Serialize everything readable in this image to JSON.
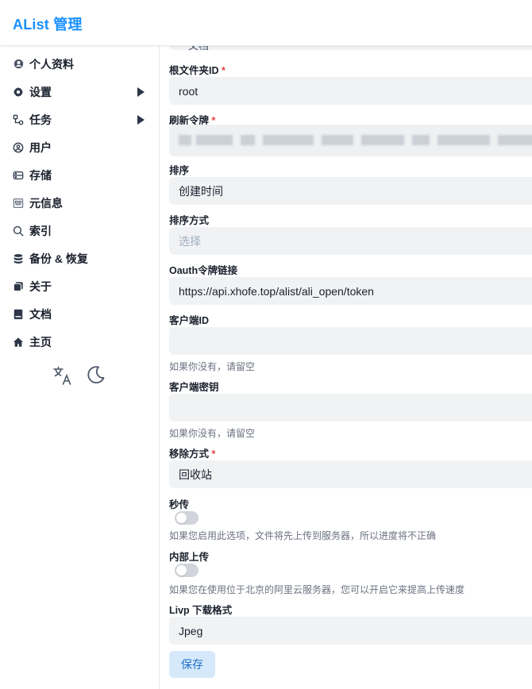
{
  "app": {
    "logo": "AList 管理"
  },
  "sidebar": {
    "items": [
      {
        "label": "个人资料",
        "icon": "user-circle-icon",
        "has_submenu": false
      },
      {
        "label": "设置",
        "icon": "gear-icon",
        "has_submenu": true
      },
      {
        "label": "任务",
        "icon": "tasks-icon",
        "has_submenu": true
      },
      {
        "label": "用户",
        "icon": "user-icon",
        "has_submenu": false
      },
      {
        "label": "存储",
        "icon": "database-icon",
        "has_submenu": false
      },
      {
        "label": "元信息",
        "icon": "meta-icon",
        "has_submenu": false
      },
      {
        "label": "索引",
        "icon": "search-icon",
        "has_submenu": false
      },
      {
        "label": "备份 & 恢复",
        "icon": "backup-icon",
        "has_submenu": false
      },
      {
        "label": "关于",
        "icon": "info-icon",
        "has_submenu": false
      },
      {
        "label": "文档",
        "icon": "book-icon",
        "has_submenu": false
      },
      {
        "label": "主页",
        "icon": "home-icon",
        "has_submenu": false
      }
    ],
    "tools": {
      "language_icon": "translate-icon",
      "theme_icon": "moon-icon"
    }
  },
  "form": {
    "cut_field_value": "文档",
    "root_folder_id": {
      "label": "根文件夹ID",
      "required": true,
      "value": "root"
    },
    "refresh_token": {
      "label": "刷新令牌",
      "required": true,
      "value_note": "blurred"
    },
    "order_by": {
      "label": "排序",
      "value": "创建时间"
    },
    "order_direction": {
      "label": "排序方式",
      "placeholder": "选择"
    },
    "oauth_token_url": {
      "label": "Oauth令牌链接",
      "value": "https://api.xhofe.top/alist/ali_open/token"
    },
    "client_id": {
      "label": "客户端ID",
      "value": "",
      "help": "如果你没有，请留空"
    },
    "client_secret": {
      "label": "客户端密钥",
      "value": "",
      "help": "如果你没有，请留空"
    },
    "remove_way": {
      "label": "移除方式",
      "required": true,
      "value": "回收站"
    },
    "rapid_upload": {
      "label": "秒传",
      "enabled": false,
      "help": "如果您启用此选项，文件将先上传到服务器，所以进度将不正确"
    },
    "internal_upload": {
      "label": "内部上传",
      "enabled": false,
      "help": "如果您在使用位于北京的阿里云服务器，您可以开启它来提高上传速度"
    },
    "livp_download_format": {
      "label": "Livp 下载格式",
      "value": "Jpeg"
    },
    "save_label": "保存"
  },
  "required_mark": "*",
  "colors": {
    "brand": "#1890ff",
    "required": "#e53e3e",
    "field_bg": "#f0f2f4",
    "save_button_bg": "#d6e9fb"
  }
}
